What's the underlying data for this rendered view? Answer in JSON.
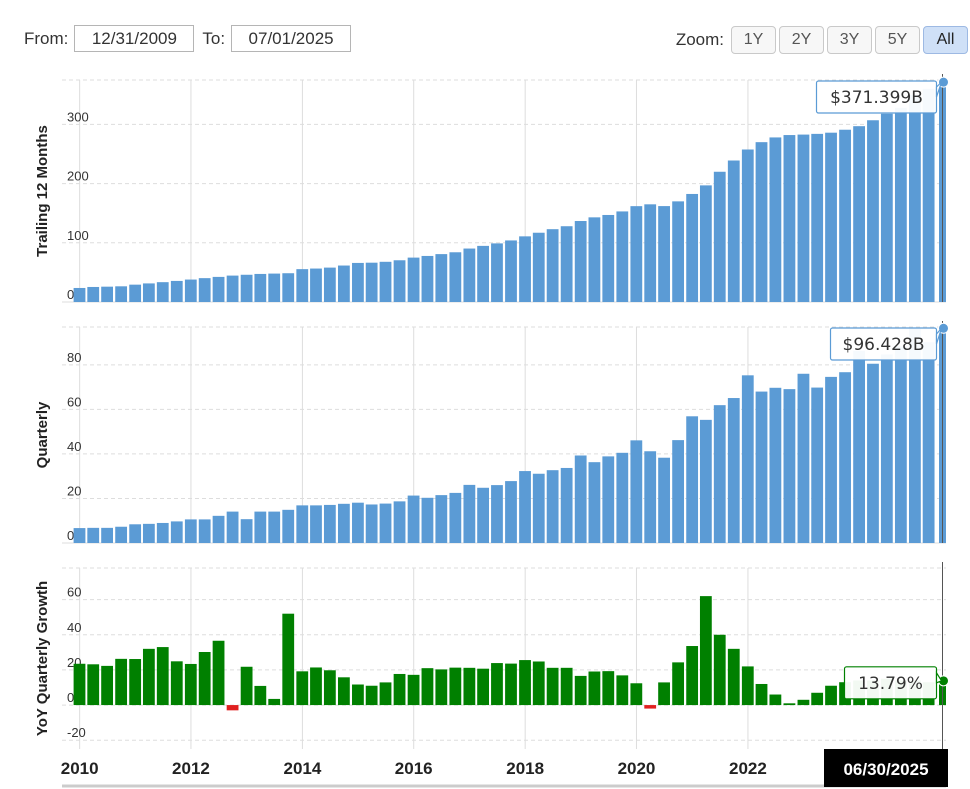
{
  "range": {
    "from_label": "From:",
    "from_value": "12/31/2009",
    "to_label": "To:",
    "to_value": "07/01/2025"
  },
  "zoom": {
    "label": "Zoom:",
    "buttons": [
      "1Y",
      "2Y",
      "3Y",
      "5Y",
      "All"
    ],
    "active": "All"
  },
  "colors": {
    "bar_blue": "#5b9bd5",
    "growth_green": "#008000",
    "growth_red": "#e02020",
    "grid": "#dddddd"
  },
  "chart_data": {
    "type": "bar",
    "x_dates": [
      "2009-12-31",
      "2010-03-31",
      "2010-06-30",
      "2010-09-30",
      "2010-12-31",
      "2011-03-31",
      "2011-06-30",
      "2011-09-30",
      "2011-12-31",
      "2012-03-31",
      "2012-06-30",
      "2012-09-30",
      "2012-12-31",
      "2013-03-31",
      "2013-06-30",
      "2013-09-30",
      "2013-12-31",
      "2014-03-31",
      "2014-06-30",
      "2014-09-30",
      "2014-12-31",
      "2015-03-31",
      "2015-06-30",
      "2015-09-30",
      "2015-12-31",
      "2016-03-31",
      "2016-06-30",
      "2016-09-30",
      "2016-12-31",
      "2017-03-31",
      "2017-06-30",
      "2017-09-30",
      "2017-12-31",
      "2018-03-31",
      "2018-06-30",
      "2018-09-30",
      "2018-12-31",
      "2019-03-31",
      "2019-06-30",
      "2019-09-30",
      "2019-12-31",
      "2020-03-31",
      "2020-06-30",
      "2020-09-30",
      "2020-12-31",
      "2021-03-31",
      "2021-06-30",
      "2021-09-30",
      "2021-12-31",
      "2022-03-31",
      "2022-06-30",
      "2022-09-30",
      "2022-12-31",
      "2023-03-31",
      "2023-06-30",
      "2023-09-30",
      "2023-12-31",
      "2024-03-31",
      "2024-06-30",
      "2024-09-30",
      "2024-12-31",
      "2025-03-31",
      "2025-06-30"
    ],
    "x_ticks": [
      "2010",
      "2012",
      "2014",
      "2016",
      "2018",
      "2020",
      "2022"
    ],
    "x_tick_years": [
      2010,
      2012,
      2014,
      2016,
      2018,
      2020,
      2022
    ],
    "cursor_date_label": "06/30/2025",
    "panels": [
      {
        "ylabel": "Trailing 12 Months",
        "yticks": [
          0,
          100,
          200,
          300
        ],
        "ylim": [
          0,
          375
        ],
        "values": [
          23.7,
          25.4,
          25.9,
          26.5,
          29.3,
          31.4,
          33.5,
          35.6,
          37.9,
          40.3,
          42.4,
          44.6,
          46.0,
          47.4,
          48.0,
          48.6,
          55.5,
          56.5,
          58.1,
          61.6,
          66.0,
          66.4,
          67.9,
          70.5,
          74.99,
          77.8,
          80.9,
          84.0,
          90.3,
          94.8,
          99.0,
          104.0,
          110.9,
          117.0,
          123.0,
          128.0,
          136.8,
          143.0,
          147.0,
          153.0,
          161.9,
          165.0,
          162.0,
          170.0,
          182.5,
          197.0,
          220.0,
          239.0,
          257.6,
          270.0,
          278.0,
          282.0,
          282.8,
          284.0,
          286.0,
          291.0,
          297.0,
          307.0,
          318.0,
          328.0,
          350.0,
          360.0,
          371.399
        ],
        "callout": "$371.399B",
        "color": "#5b9bd5"
      },
      {
        "ylabel": "Quarterly",
        "yticks": [
          0,
          20,
          40,
          60,
          80
        ],
        "ylim": [
          0,
          97
        ],
        "values": [
          6.7,
          6.8,
          6.8,
          7.3,
          8.4,
          8.6,
          9.0,
          9.7,
          10.6,
          10.6,
          12.2,
          14.1,
          10.7,
          14.1,
          14.1,
          14.9,
          16.9,
          16.9,
          17.1,
          17.6,
          18.1,
          17.3,
          17.7,
          18.7,
          21.3,
          20.3,
          21.5,
          22.5,
          26.1,
          24.8,
          26.0,
          27.8,
          32.3,
          31.1,
          32.7,
          33.7,
          39.3,
          36.3,
          38.9,
          40.5,
          46.1,
          41.2,
          38.3,
          46.2,
          56.9,
          55.3,
          61.9,
          65.1,
          75.3,
          68.0,
          69.7,
          69.1,
          76.0,
          69.8,
          74.6,
          76.7,
          86.3,
          80.5,
          84.7,
          88.3,
          96.5,
          90.2,
          96.428
        ],
        "callout": "$96.428B",
        "color": "#5b9bd5"
      },
      {
        "ylabel": "YoY Quarterly Growth",
        "yticks": [
          -20,
          0,
          20,
          40,
          60
        ],
        "ylim": [
          -25,
          78
        ],
        "values": [
          23.5,
          23.2,
          22.3,
          26.3,
          26.2,
          32.0,
          33.0,
          24.9,
          23.4,
          30.2,
          36.6,
          -3.0,
          21.8,
          10.9,
          3.5,
          52.0,
          19.2,
          21.4,
          19.8,
          15.8,
          11.7,
          11.0,
          12.9,
          17.7,
          17.2,
          21.0,
          20.3,
          21.3,
          21.2,
          20.7,
          23.9,
          23.6,
          25.6,
          24.8,
          21.2,
          21.2,
          16.6,
          19.1,
          19.3,
          16.9,
          12.4,
          -2.0,
          12.9,
          24.3,
          33.6,
          62.0,
          40.0,
          32.0,
          22.0,
          12.0,
          6.0,
          1.0,
          3.0,
          7.0,
          11.0,
          13.0,
          14.0,
          14.0,
          15.0,
          14.0,
          14.0,
          13.0,
          13.79
        ],
        "callout": "13.79%",
        "color": "#008000",
        "neg_color": "#e02020"
      }
    ]
  }
}
